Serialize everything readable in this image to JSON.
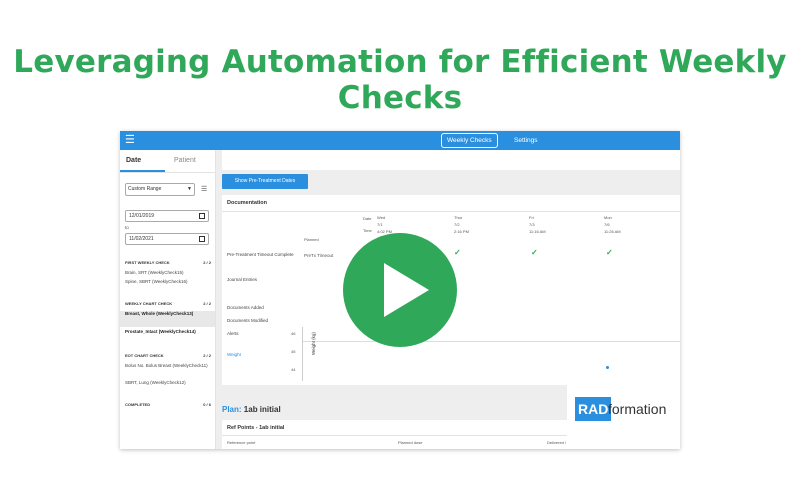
{
  "headline": "Leveraging Automation for Efficient Weekly Checks",
  "colors": {
    "accent": "#2fa85a",
    "brand_blue": "#2b8fe0"
  },
  "topbar": {
    "menu_icon": "hamburger-icon",
    "tabs": [
      {
        "label": "Weekly Checks",
        "active": true
      },
      {
        "label": "Settings",
        "active": false
      }
    ]
  },
  "sidebar": {
    "tabs": [
      {
        "label": "Date"
      },
      {
        "label": "Patient"
      }
    ],
    "range_select": "Custom Range",
    "from_date": "12/01/2019",
    "to_label": "to",
    "to_date": "11/02/2021",
    "sections": [
      {
        "title": "FIRST WEEKLY CHECK",
        "count": "2 / 2",
        "items": [
          "Brain, SRT (WeeklyCheck15)",
          "Spine, SBRT (WeeklyCheck16)"
        ]
      },
      {
        "title": "WEEKLY CHART CHECK",
        "count": "2 / 2",
        "items": [
          "Breast, Whole (WeeklyCheck13)",
          "Prostate_Intact (WeeklyCheck14)"
        ]
      },
      {
        "title": "EOT CHART CHECK",
        "count": "2 / 2",
        "items": [
          "Bolus No. Bolus Breast (WeeklyCheck11)",
          "SBRT, Lung (WeeklyCheck12)"
        ]
      },
      {
        "title": "COMPLETED",
        "count": "0 / 6",
        "items": []
      }
    ]
  },
  "main": {
    "show_button": "Show Pre-Treatment Dates",
    "documentation": {
      "title": "Documentation",
      "date_label": "Date",
      "time_label": "Time",
      "planned_label": "Planned",
      "columns": [
        {
          "day": "Wed",
          "date": "7/1",
          "time": "4:02 PM"
        },
        {
          "day": "Thur",
          "date": "7/2",
          "time": "2:16 PM"
        },
        {
          "day": "Fri",
          "date": "7/3",
          "time": "11:16 AM"
        },
        {
          "day": "Mon",
          "date": "7/6",
          "time": "11:26 AM"
        }
      ],
      "rows": [
        "Pre-Treatment Timeout Complete",
        "Journal Entries",
        "Documents Added",
        "Documents Modified",
        "Alerts"
      ],
      "timeout_cell": "PreTx Timeout",
      "weight_label": "Weight",
      "weight_axis": "Weight (kg)",
      "weight_ticks": [
        "46",
        "45",
        "44"
      ]
    },
    "plan": {
      "prefix": "Plan:",
      "name": "1ab initial"
    },
    "ref_points": {
      "title": "Ref Points - 1ab initial",
      "columns": [
        "Reference point",
        "Planned dose",
        "Delivered / 1"
      ]
    }
  },
  "video": {
    "play_icon": "play-icon"
  },
  "logo": {
    "part1": "RAD",
    "part2": "formation"
  }
}
